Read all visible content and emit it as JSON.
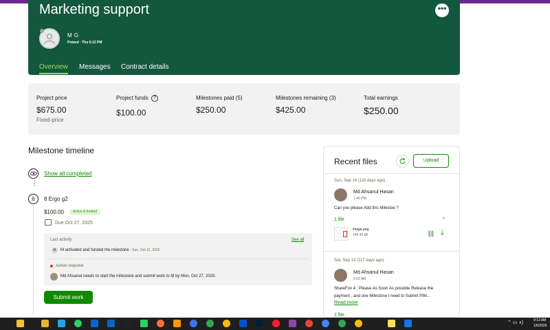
{
  "header": {
    "title": "Marketing support",
    "more_label": "•••",
    "client": {
      "name": "M G",
      "meta": "Poland · Thu 6:12 PM"
    },
    "tabs": [
      {
        "label": "Overview",
        "active": true
      },
      {
        "label": "Messages",
        "active": false
      },
      {
        "label": "Contract details",
        "active": false
      }
    ]
  },
  "stats": [
    {
      "label": "Project price",
      "value": "$675.00",
      "sub": "Fixed-price"
    },
    {
      "label": "Project funds",
      "value": "$100.00",
      "help": "?"
    },
    {
      "label": "Milestones paid (5)",
      "value": "$250.00"
    },
    {
      "label": "Milestones remaining (3)",
      "value": "$425.00"
    },
    {
      "label": "Total earnings",
      "value": "$250.00"
    }
  ],
  "timeline": {
    "heading": "Milestone timeline",
    "show_completed": "Show all completed",
    "milestone": {
      "number": "6",
      "title": "8 Ergo g2",
      "amount": "$100.00",
      "status": "Active & funded",
      "due": "Due Oct 27, 2025"
    },
    "activity": {
      "label": "Last activity",
      "see_all": "See all",
      "initial": "M",
      "text": "M activated and funded the milestone",
      "time": " - Sun, Oct 12, 2025",
      "action_label": "Action required",
      "action_text": "Md Ahsanul needs to start the milestone and submit work to M by Mon, Oct 27, 2025."
    },
    "submit_label": "Submit work"
  },
  "files": {
    "heading": "Recent files",
    "upload_label": "Upload",
    "entries": [
      {
        "date": "Sun, Sep 14 (116 days ago)",
        "sender": "Md Ahsanul Hasan",
        "time": "1:46 PM",
        "message": "Can you please Add this Milestoe ?",
        "file_count": "1 file",
        "file_name": "image.png",
        "file_size": "149.45 kB"
      },
      {
        "date": "Sat, Sep 13 (117 days ago)",
        "sender": "Md Ahsanul Hasan",
        "time": "5:02 AM",
        "message_line1": "ShareFox 4 , Please As Soon As possible Release the",
        "message_line2": "payment , and one Milestone I need to Submit PIM...",
        "read_more": "Read more",
        "file_count": "1 file"
      }
    ]
  },
  "taskbar": {
    "time": "9:13 AM",
    "date": "1/6/2026",
    "icons": [
      "copilot",
      "file-explorer",
      "telegram",
      "whatsapp",
      "outlook",
      "linkedin",
      "upwork",
      "whatsapp-business",
      "firefox",
      "sublime",
      "signal",
      "chrome",
      "chrome",
      "jira",
      "photoshop",
      "opera",
      "app",
      "chrome",
      "chrome",
      "chrome",
      "chrome",
      "sticky-notes",
      "cursor"
    ],
    "icon_colors": [
      "#f6c23e",
      "#e8b339",
      "#2aa3e0",
      "#25d366",
      "#0a64d8",
      "#0a66c2",
      "#222222",
      "#25d366",
      "#ff7139",
      "#ff9800",
      "#3a76f0",
      "#34a853",
      "#fbbc05",
      "#0052cc",
      "#001e36",
      "#ff1b2d",
      "#8e44ad",
      "#ea4335",
      "#4285f4",
      "#34a853",
      "#fbbc05",
      "#f7e15c",
      "#1a73e8"
    ]
  },
  "colors": {
    "brand": "#14573f",
    "accent": "#108a00",
    "highlight": "#9be15d"
  }
}
